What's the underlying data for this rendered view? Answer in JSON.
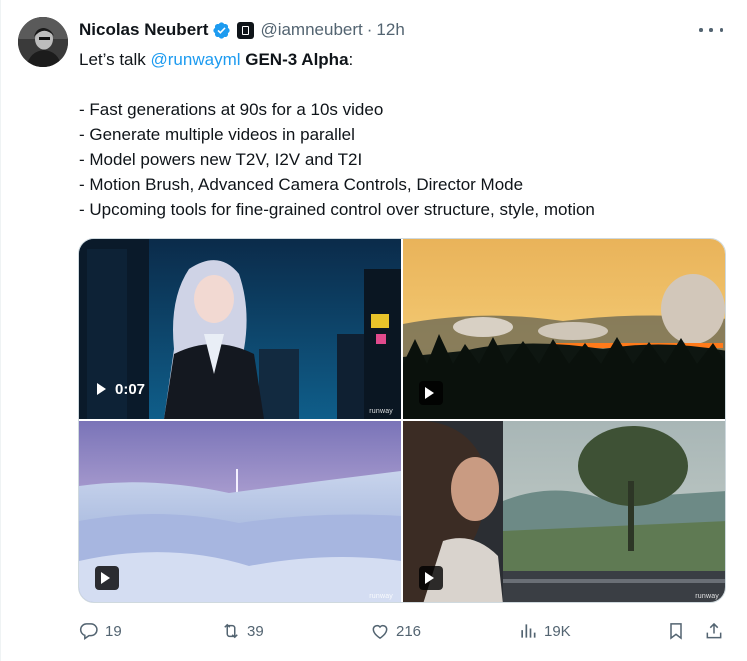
{
  "author": {
    "name": "Nicolas Neubert",
    "handle": "@iamneubert",
    "separator": "·",
    "time": "12h",
    "verified_icon": "verified-badge-icon",
    "affiliation_icon": "affiliate-badge-icon"
  },
  "tweet": {
    "intro_prefix": "Let’s talk ",
    "mention": "@runwayml",
    "intro_space": " ",
    "intro_bold": "GEN-3 Alpha",
    "intro_suffix": ":",
    "bullets": [
      "- Fast generations at 90s for a 10s video",
      "- Generate multiple videos in parallel",
      "- Model powers new T2V, I2V and T2I",
      "- Motion Brush, Advanced Camera Controls, Director Mode",
      "- Upcoming tools for fine-grained control over structure, style, motion"
    ]
  },
  "media": {
    "videos": [
      {
        "duration": "0:07",
        "watermark": "runway",
        "scene": "anime girl in neon city"
      },
      {
        "duration": "",
        "watermark": "",
        "scene": "forest fire at dusk"
      },
      {
        "duration": "",
        "watermark": "runway",
        "scene": "snowy landscape at twilight"
      },
      {
        "duration": "",
        "watermark": "runway",
        "scene": "woman at train window"
      }
    ]
  },
  "actions": {
    "replies": "19",
    "reposts": "39",
    "likes": "216",
    "views": "19K"
  },
  "colors": {
    "accent": "#1d9bf0",
    "secondary_text": "#536471",
    "text": "#0f1419",
    "border": "#cfd9de"
  }
}
